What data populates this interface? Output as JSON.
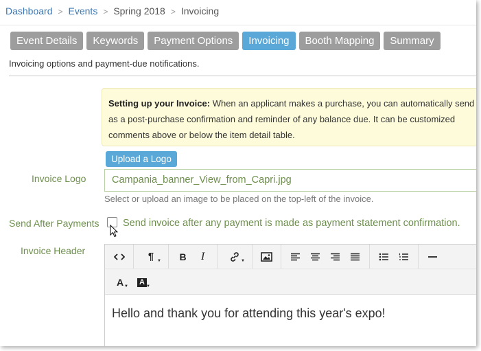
{
  "breadcrumb": {
    "items": [
      "Dashboard",
      "Events",
      "Spring 2018",
      "Invoicing"
    ],
    "separator": ">"
  },
  "tabs": [
    {
      "label": "Event Details",
      "active": false
    },
    {
      "label": "Keywords",
      "active": false
    },
    {
      "label": "Payment Options",
      "active": false
    },
    {
      "label": "Invoicing",
      "active": true
    },
    {
      "label": "Booth Mapping",
      "active": false
    },
    {
      "label": "Summary",
      "active": false
    }
  ],
  "tab_description": "Invoicing options and payment-due notifications.",
  "callout": {
    "bold_lead": "Setting up your Invoice:",
    "line1_rest": "When an applicant makes a purchase, you can automatically send",
    "line2": "as a post-purchase confirmation and reminder of any balance due. It can be customized",
    "line3": "comments above or below the item detail table."
  },
  "logo": {
    "upload_button": "Upload a Logo",
    "label": "Invoice Logo",
    "value": "Campania_banner_View_from_Capri.jpg",
    "help": "Select or upload an image to be placed on the top-left of the invoice."
  },
  "send_after": {
    "label": "Send After Payments",
    "checked": false,
    "checkbox_label": "Send invoice after any payment is made as payment statement confirmation."
  },
  "header": {
    "label": "Invoice Header",
    "content": "Hello and thank you for attending this year's expo!"
  },
  "toolbar_icons": {
    "row1": [
      "code-view-icon",
      "paragraph-style-icon",
      "bold-icon",
      "italic-icon",
      "link-icon",
      "image-icon",
      "align-left-icon",
      "align-center-icon",
      "align-right-icon",
      "align-justify-icon",
      "bulleted-list-icon",
      "numbered-list-icon",
      "horizontal-rule-icon"
    ],
    "row2": [
      "text-color-icon",
      "background-color-icon"
    ]
  },
  "colors": {
    "active_tab": "#5aa8d8",
    "inactive_tab": "#9d9d9d",
    "link": "#3a78b5",
    "label_green": "#6d8f4c",
    "callout_bg": "#fdfbd9"
  }
}
